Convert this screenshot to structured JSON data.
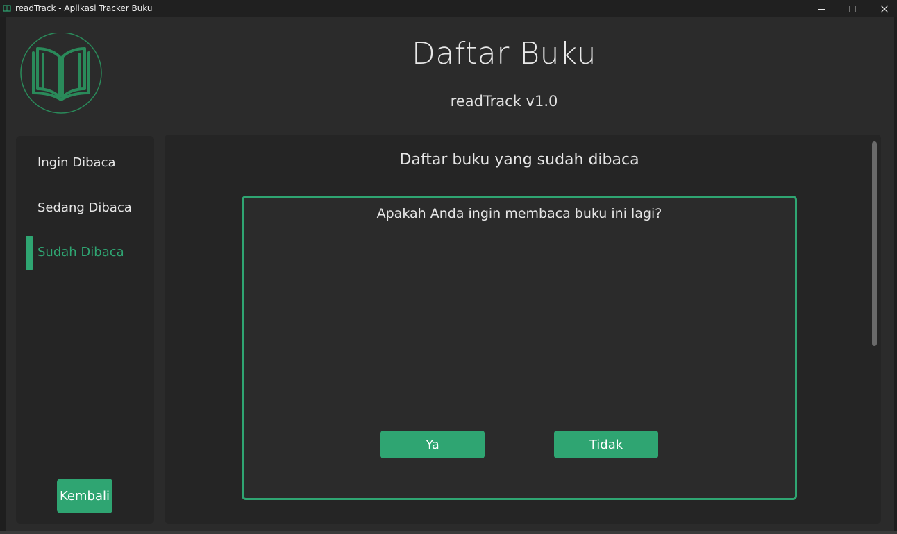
{
  "window": {
    "title": "readTrack - Aplikasi Tracker Buku",
    "controls": [
      "minimize-icon",
      "maximize-icon",
      "close-icon"
    ]
  },
  "header": {
    "logo_icon": "open-book-icon",
    "title": "Daftar Buku",
    "subtitle": "readTrack v1.0"
  },
  "sidebar": {
    "items": [
      {
        "label": "Ingin Dibaca",
        "active": false
      },
      {
        "label": "Sedang Dibaca",
        "active": false
      },
      {
        "label": "Sudah Dibaca",
        "active": true
      }
    ],
    "back_label": "Kembali"
  },
  "main": {
    "title": "Daftar buku yang sudah dibaca",
    "dialog": {
      "question": "Apakah Anda ingin membaca buku ini lagi?",
      "yes_label": "Ya",
      "no_label": "Tidak"
    }
  },
  "colors": {
    "accent": "#2fa572",
    "background": "#2b2b2b",
    "panel": "#252525",
    "titlebar": "#202020",
    "text": "#e6e6e6"
  }
}
